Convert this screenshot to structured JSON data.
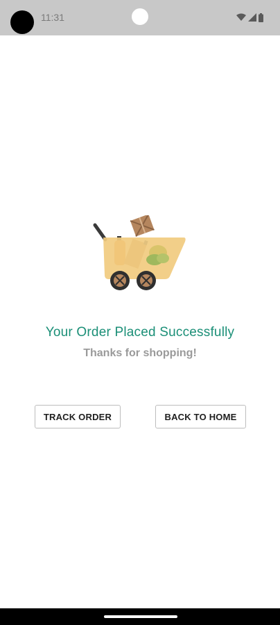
{
  "status_bar": {
    "time": "11:31",
    "icons": [
      "wifi-icon",
      "signal-icon",
      "battery-icon"
    ]
  },
  "illustration": {
    "icon": "shopping-cart-illustration"
  },
  "message": {
    "title": "Your Order Placed Successfully",
    "subtitle": "Thanks for shopping!"
  },
  "actions": {
    "track_order_label": "TRACK ORDER",
    "back_to_home_label": "BACK TO HOME"
  },
  "colors": {
    "accent": "#1b8f77",
    "subtitle": "#9a9a9a",
    "status_bar": "#c8c8c8",
    "cart_body": "#f1cb7f"
  }
}
